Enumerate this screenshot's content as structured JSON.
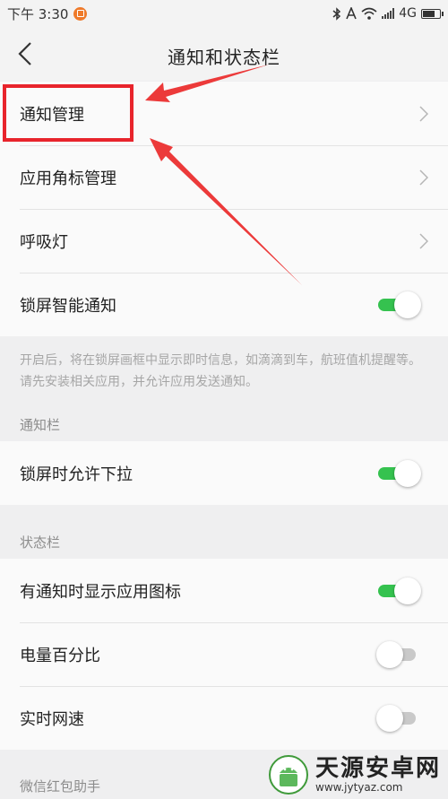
{
  "status": {
    "time": "下午 3:30",
    "network": "4G",
    "icons": [
      "bluetooth-icon",
      "nfc-icon",
      "wifi-icon",
      "signal-icon",
      "battery-icon"
    ]
  },
  "header": {
    "title": "通知和状态栏"
  },
  "group1": {
    "items": [
      {
        "label": "通知管理",
        "control": "chevron"
      },
      {
        "label": "应用角标管理",
        "control": "chevron"
      },
      {
        "label": "呼吸灯",
        "control": "chevron"
      },
      {
        "label": "锁屏智能通知",
        "control": "toggle",
        "on": true
      }
    ],
    "note": "开启后，将在锁屏画框中显示即时信息，如滴滴到车，航班值机提醒等。请先安装相关应用，并允许应用发送通知。"
  },
  "section_notification": {
    "header": "通知栏",
    "items": [
      {
        "label": "锁屏时允许下拉",
        "control": "toggle",
        "on": true
      }
    ]
  },
  "section_status": {
    "header": "状态栏",
    "items": [
      {
        "label": "有通知时显示应用图标",
        "control": "toggle",
        "on": true
      },
      {
        "label": "电量百分比",
        "control": "toggle",
        "on": false
      },
      {
        "label": "实时网速",
        "control": "toggle",
        "on": false
      }
    ]
  },
  "section_wechat": {
    "header": "微信红包助手"
  },
  "watermark": {
    "title": "天源安卓网",
    "url": "www.jytyaz.com"
  },
  "colors": {
    "accent_green": "#35c24f",
    "highlight_red": "#e8242c",
    "background": "#efeff0",
    "card": "#fafafa"
  }
}
